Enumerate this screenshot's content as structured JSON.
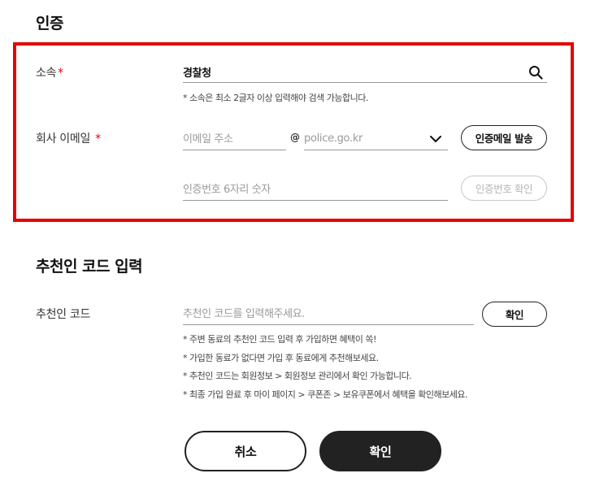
{
  "auth": {
    "title": "인증",
    "affiliation": {
      "label": "소속",
      "required_mark": "*",
      "value": "경찰청",
      "hint": "* 소속은 최소 2글자 이상 입력해야 검색 가능합니다."
    },
    "email": {
      "label": "회사 이메일",
      "required_mark": "*",
      "local_placeholder": "이메일 주소",
      "at_sign": "@",
      "domain_selected": "police.go.kr",
      "send_button": "인증메일 발송",
      "code_placeholder": "인증번호 6자리 숫자",
      "verify_button": "인증번호 확인"
    }
  },
  "referral": {
    "title": "추천인 코드 입력",
    "label": "추천인 코드",
    "placeholder": "추천인 코드를 입력해주세요.",
    "confirm_button": "확인",
    "notes": [
      "* 주변 동료의 추천인 코드 입력 후 가입하면 혜택이 쏙!",
      "* 가입한 동료가 없다면 가입 후 동료에게 추천해보세요.",
      "* 추천인 코드는 회원정보 > 회원정보 관리에서 확인 가능합니다.",
      "* 최종 가입 완료 후 마이 페이지 > 쿠폰존 > 보유쿠폰에서 혜택을 확인해보세요."
    ]
  },
  "footer": {
    "cancel": "취소",
    "confirm": "확인"
  },
  "colors": {
    "highlight_frame": "#e60000",
    "required": "#e60000",
    "primary_button": "#222222"
  }
}
